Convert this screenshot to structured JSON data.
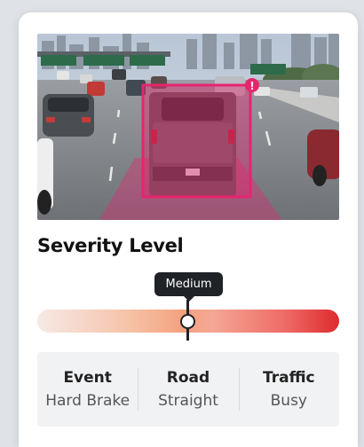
{
  "card": {
    "title": "Severity Level",
    "alert_badge": "!",
    "severity": {
      "label": "Medium",
      "level": 0.5
    },
    "stats": [
      {
        "label": "Event",
        "value": "Hard Brake"
      },
      {
        "label": "Road",
        "value": "Straight"
      },
      {
        "label": "Traffic",
        "value": "Busy"
      }
    ]
  },
  "colors": {
    "highlight": "#e8246e",
    "severity_low": "#f6e9e6",
    "severity_mid": "#f4a27e",
    "severity_high": "#df2a2e",
    "tooltip": "#1f2226"
  }
}
